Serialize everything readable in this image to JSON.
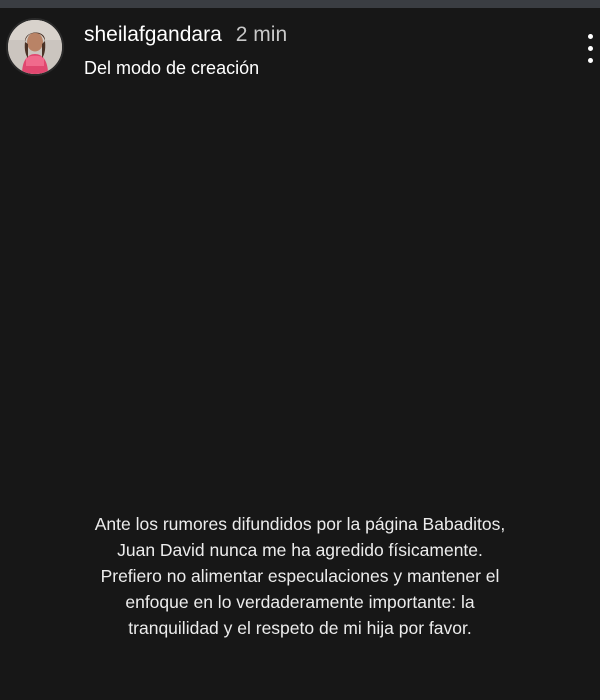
{
  "story": {
    "progress": 0.0,
    "header": {
      "username": "sheilafgandara",
      "timestamp": "2 min",
      "subtitle": "Del modo de creación",
      "more_icon": "more-vertical-icon"
    },
    "caption_lines": [
      "Ante los rumores difundidos por la página Babaditos,",
      "Juan David nunca me ha agredido físicamente.",
      "Prefiero no alimentar especulaciones y mantener el",
      "enfoque en lo verdaderamente importante: la",
      "tranquilidad y el respeto de mi hija por favor."
    ]
  },
  "colors": {
    "background": "#171717",
    "text": "#ffffff",
    "timestamp": "#c8c8c8"
  }
}
